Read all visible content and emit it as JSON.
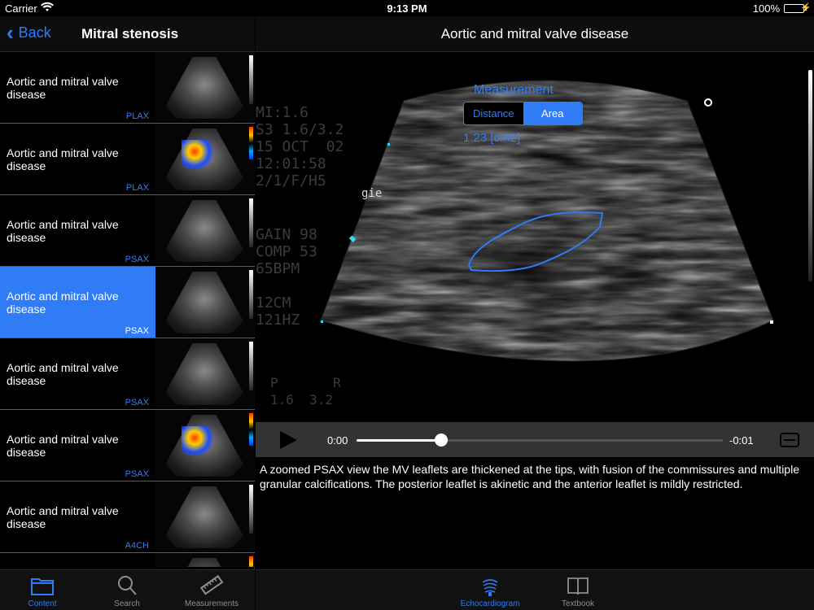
{
  "status": {
    "carrier": "Carrier",
    "time": "9:13 PM",
    "battery": "100%"
  },
  "sidebar": {
    "back_label": "Back",
    "title": "Mitral stenosis",
    "items": [
      {
        "label": "Aortic and mitral valve disease",
        "view": "PLAX",
        "doppler": false,
        "selected": false
      },
      {
        "label": "Aortic and mitral valve disease",
        "view": "PLAX",
        "doppler": true,
        "selected": false
      },
      {
        "label": "Aortic and mitral valve disease",
        "view": "PSAX",
        "doppler": false,
        "selected": false
      },
      {
        "label": "Aortic and mitral valve disease",
        "view": "PSAX",
        "doppler": false,
        "selected": true
      },
      {
        "label": "Aortic and mitral valve disease",
        "view": "PSAX",
        "doppler": false,
        "selected": false
      },
      {
        "label": "Aortic and mitral valve disease",
        "view": "PSAX",
        "doppler": true,
        "selected": false
      },
      {
        "label": "Aortic and mitral valve disease",
        "view": "A4CH",
        "doppler": false,
        "selected": false
      },
      {
        "label": "",
        "view": "",
        "doppler": true,
        "selected": false
      }
    ],
    "tabs": [
      {
        "label": "Content",
        "icon": "folder-icon",
        "active": true
      },
      {
        "label": "Search",
        "icon": "search-icon",
        "active": false
      },
      {
        "label": "Measurements",
        "icon": "ruler-icon",
        "active": false
      }
    ]
  },
  "main": {
    "title": "Aortic and mitral valve  disease",
    "overlay": {
      "header": "MI:1.6\nS3 1.6/3.2\n15 OCT  02\n12:01:58\n2/1/F/H5",
      "settings": "GAIN 98\nCOMP 53\n65BPM\n\n12CM\n121HZ",
      "marker": "gie",
      "bottom": "P       R\n1.6  3.2"
    },
    "measurement": {
      "title": "Measurement",
      "modes": [
        "Distance",
        "Area"
      ],
      "active_mode": "Area",
      "value": "1.23 [cm2]"
    },
    "player": {
      "current_time": "0:00",
      "remaining_time": "-0:01",
      "progress": 0.23
    },
    "description": "A zoomed PSAX view the MV leaflets are thickened at the tips, with fusion of the commissures and multiple granular calcifications. The posterior leaflet is akinetic and the anterior leaflet is mildly restricted.",
    "tabs": [
      {
        "label": "Echocardiogram",
        "icon": "ultrasound-probe-icon",
        "active": true
      },
      {
        "label": "Textbook",
        "icon": "book-icon",
        "active": false
      }
    ]
  },
  "colors": {
    "accent": "#2f7cf6",
    "selected_row": "#2f7cf6",
    "battery": "#4cd964"
  }
}
